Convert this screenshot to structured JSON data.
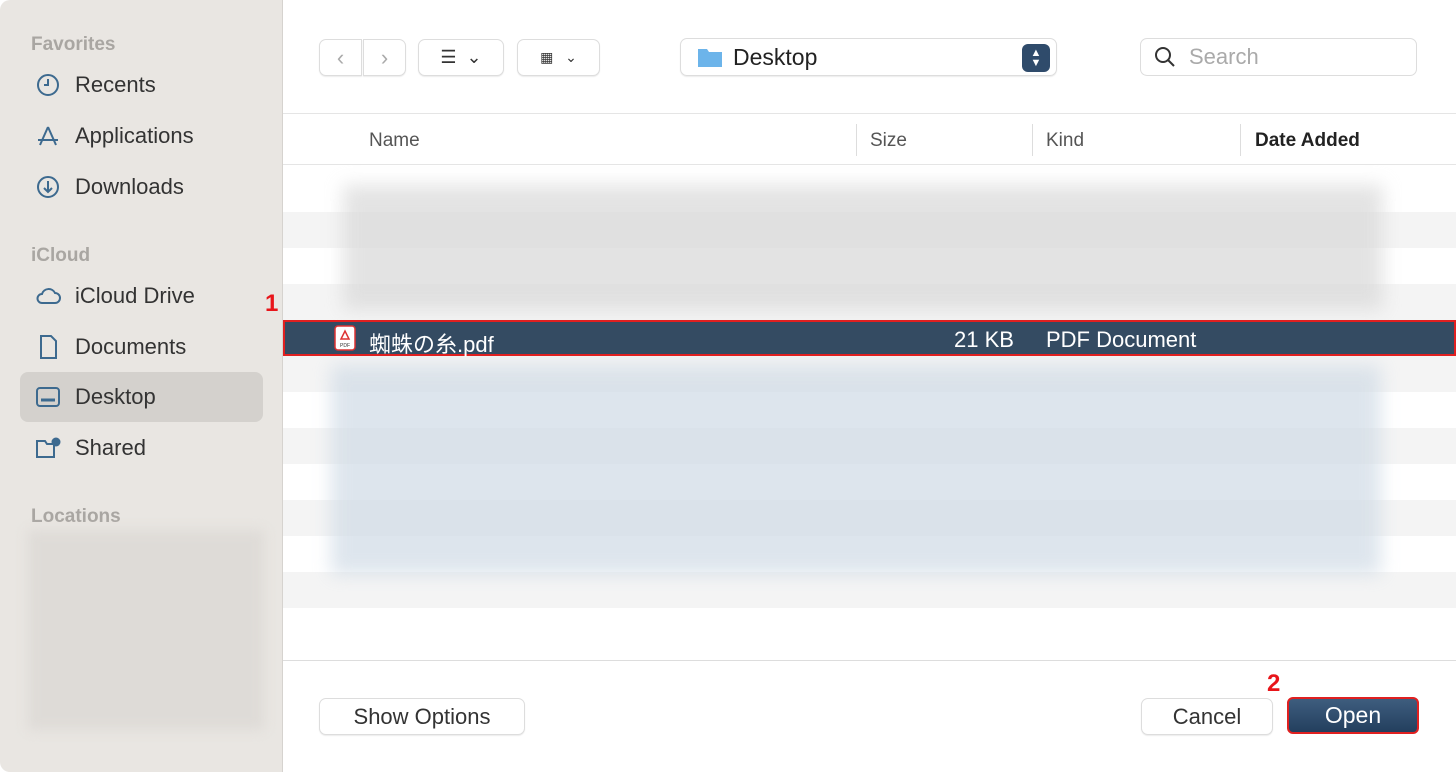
{
  "sidebar": {
    "sections": [
      "Favorites",
      "iCloud",
      "Locations"
    ],
    "items": [
      {
        "label": "Recents",
        "icon": "clock-icon"
      },
      {
        "label": "Applications",
        "icon": "applications-icon"
      },
      {
        "label": "Downloads",
        "icon": "download-icon"
      },
      {
        "label": "iCloud Drive",
        "icon": "cloud-icon"
      },
      {
        "label": "Documents",
        "icon": "document-icon"
      },
      {
        "label": "Desktop",
        "icon": "desktop-icon",
        "selected": true
      },
      {
        "label": "Shared",
        "icon": "shared-folder-icon"
      }
    ]
  },
  "toolbar": {
    "location": "Desktop",
    "search_placeholder": "Search"
  },
  "columns": [
    "Name",
    "Size",
    "Kind",
    "Date Added"
  ],
  "selected_file": {
    "name": "蜘蛛の糸.pdf",
    "size": "21 KB",
    "kind": "PDF Document"
  },
  "annotations": [
    "1",
    "2"
  ],
  "footer": {
    "show_options": "Show Options",
    "cancel": "Cancel",
    "open": "Open"
  },
  "colors": {
    "accent": "#344b62",
    "annotation": "#e02020"
  }
}
